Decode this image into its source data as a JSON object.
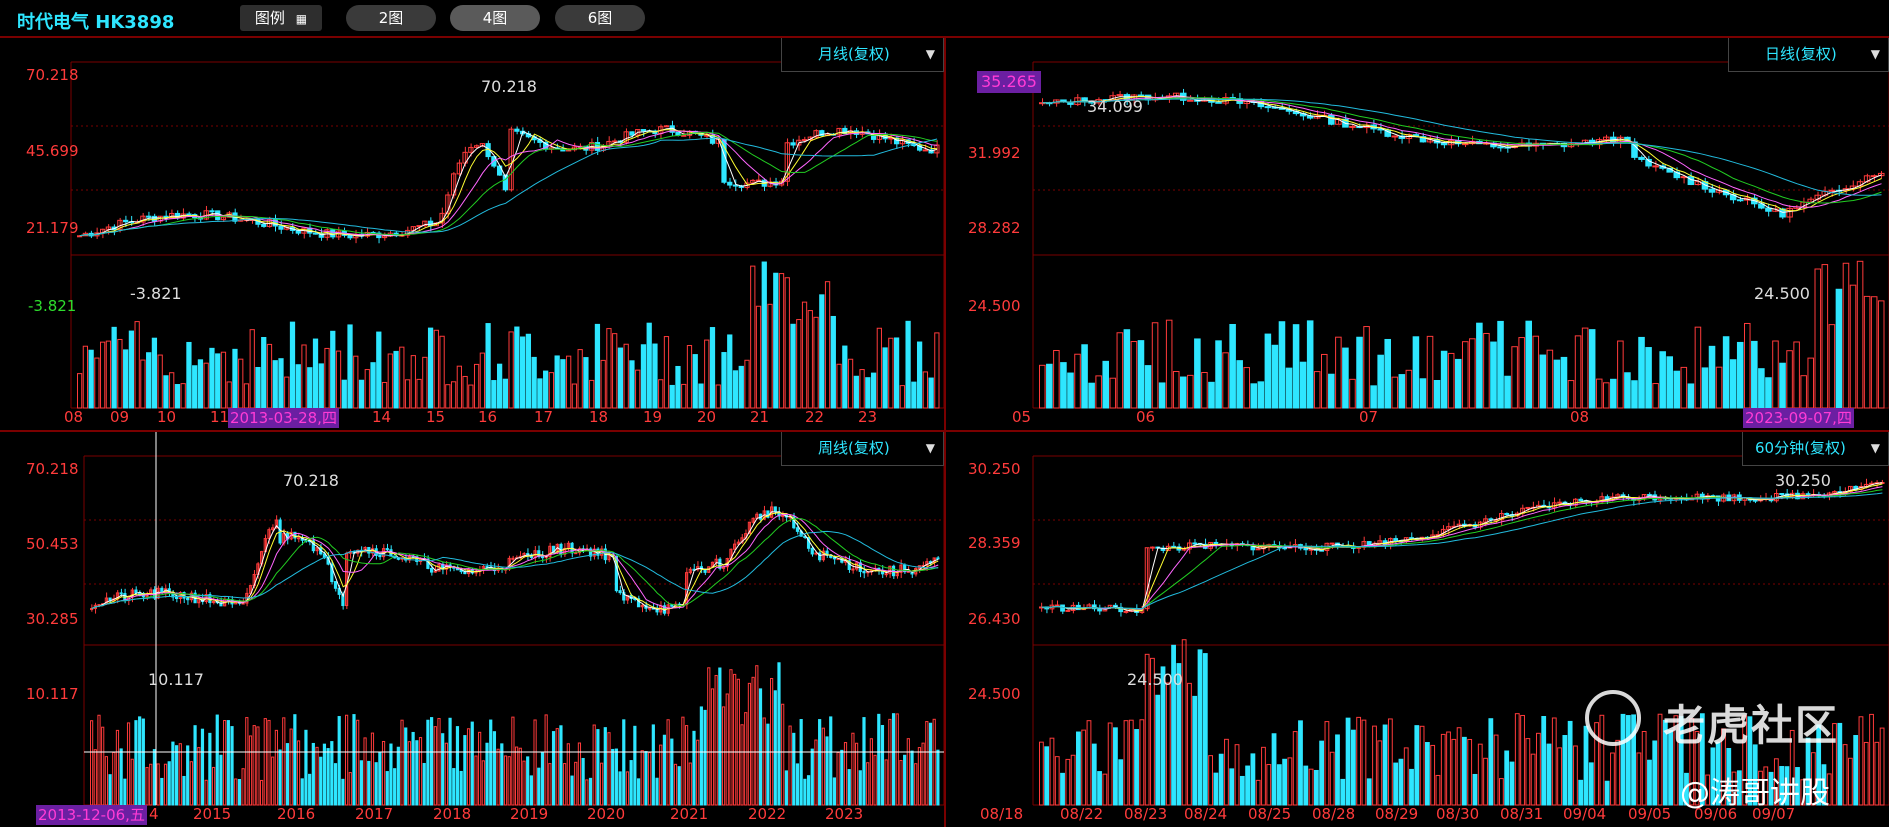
{
  "topbar": {
    "title": "时代电气 HK3898",
    "legend_label": "图例",
    "layout_buttons": [
      "2图",
      "4图",
      "6图"
    ],
    "active_layout": "4图"
  },
  "panels": {
    "monthly": {
      "period_label": "月线(复权)",
      "y_labels": [
        "70.218",
        "45.699",
        "21.179",
        "-3.821"
      ],
      "x_labels": [
        "08",
        "09",
        "10",
        "11",
        "14",
        "15",
        "16",
        "17",
        "18",
        "19",
        "20",
        "21",
        "22",
        "23"
      ],
      "highlight_date": "2013-03-28,四",
      "peak_label": "70.218",
      "low_label": "-3.821"
    },
    "daily": {
      "period_label": "日线(复权)",
      "current_price": "35.265",
      "y_labels": [
        "31.992",
        "28.282",
        "24.500"
      ],
      "x_labels": [
        "05",
        "06",
        "07",
        "08"
      ],
      "highlight_date": "2023-09-07,四",
      "peak_label": "34.099",
      "low_label": "24.500"
    },
    "weekly": {
      "period_label": "周线(复权)",
      "y_labels": [
        "70.218",
        "50.453",
        "30.285",
        "10.117"
      ],
      "x_labels": [
        "2015",
        "2016",
        "2017",
        "2018",
        "2019",
        "2020",
        "2021",
        "2022",
        "2023"
      ],
      "highlight_date": "2013-12-06,五",
      "partial_x_label": "4",
      "peak_label": "70.218",
      "low_label": "10.117"
    },
    "min60": {
      "period_label": "60分钟(复权)",
      "y_labels": [
        "30.250",
        "28.359",
        "26.430",
        "24.500"
      ],
      "x_labels": [
        "08/18",
        "08/22",
        "08/23",
        "08/24",
        "08/25",
        "08/28",
        "08/29",
        "08/30",
        "08/31",
        "09/04",
        "09/05",
        "09/06",
        "09/07"
      ],
      "peak_label": "30.250",
      "low_label": "24.500"
    }
  },
  "watermark": {
    "brand": "老虎社区",
    "author": "@涛哥讲股"
  },
  "colors": {
    "up": "#ff3b3b",
    "down": "#2ee6ff",
    "ma5": "#ffffff",
    "ma10": "#ffff33",
    "ma20": "#ff66ff",
    "ma30": "#22cc22",
    "ma60": "#22bbdd",
    "grid": "#7a0000"
  }
}
